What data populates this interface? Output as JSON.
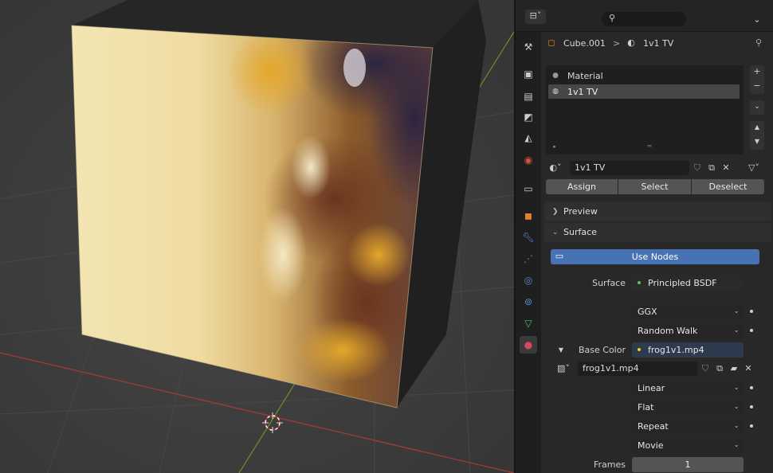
{
  "breadcrumb": {
    "object": "Cube.001",
    "separator": ">",
    "material": "1v1 TV"
  },
  "material_slots": [
    {
      "name": "Material",
      "selected": false
    },
    {
      "name": "1v1 TV",
      "selected": true
    }
  ],
  "material_selector": {
    "name": "1v1 TV"
  },
  "slot_buttons": {
    "assign": "Assign",
    "select": "Select",
    "deselect": "Deselect"
  },
  "sections": {
    "preview": "Preview",
    "surface": "Surface"
  },
  "use_nodes_label": "Use Nodes",
  "surface": {
    "label": "Surface",
    "shader": "Principled BSDF",
    "distribution": "GGX",
    "subsurface_method": "Random Walk",
    "base_color_label": "Base Color",
    "base_color_value": "frog1v1.mp4",
    "image_name": "frog1v1.mp4",
    "interpolation": "Linear",
    "projection": "Flat",
    "extension": "Repeat",
    "source": "Movie",
    "frames_label": "Frames",
    "frames_value": "1"
  },
  "colors": {
    "accent_blue": "#4772b3",
    "shader_dot": "#51c16a",
    "color_dot": "#e6d12c",
    "grid_x_axis": "#a33a3a",
    "grid_y_axis": "#7a9a28"
  },
  "icons": {
    "editor_type": "properties-editor-icon",
    "search": "search-icon",
    "pin": "pin-icon",
    "object": "object-icon",
    "material": "material-icon"
  }
}
